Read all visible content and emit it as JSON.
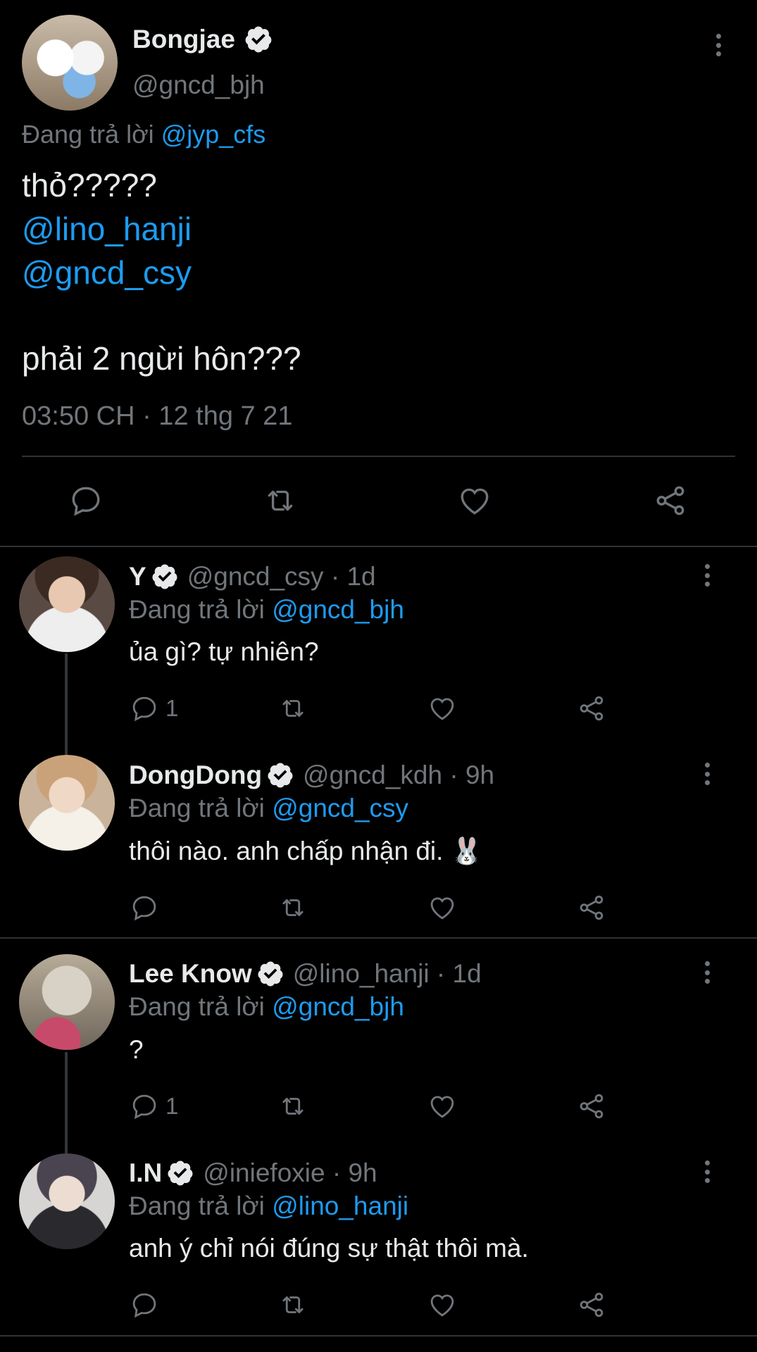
{
  "main_tweet": {
    "name": "Bongjae",
    "handle": "@gncd_bjh",
    "replying_prefix": "Đang trả lời ",
    "replying_to": "@jyp_cfs",
    "line1": "thỏ?????",
    "mention1": "@lino_hanji",
    "mention2": "@gncd_csy",
    "line2": "phải 2 ngừi hôn???",
    "timestamp": "03:50 CH · 12 thg 7 21"
  },
  "replies": [
    {
      "name": "Y",
      "handle": "@gncd_csy · 1d",
      "replying_prefix": "Đang trả lời ",
      "replying_to": "@gncd_bjh",
      "text": "ủa gì? tự nhiên?",
      "reply_count": "1"
    },
    {
      "name": "DongDong",
      "handle": "@gncd_kdh · 9h",
      "replying_prefix": "Đang trả lời ",
      "replying_to": "@gncd_csy",
      "text": "thôi nào. anh chấp nhận đi. 🐰",
      "reply_count": ""
    },
    {
      "name": "Lee Know",
      "handle": "@lino_hanji · 1d",
      "replying_prefix": "Đang trả lời ",
      "replying_to": "@gncd_bjh",
      "text": "?",
      "reply_count": "1"
    },
    {
      "name": "I.N",
      "handle": "@iniefoxie · 9h",
      "replying_prefix": "Đang trả lời ",
      "replying_to": "@lino_hanji",
      "text": "anh ý chỉ nói đúng sự thật thôi mà.",
      "reply_count": ""
    }
  ],
  "icons": {
    "reply": "reply-icon",
    "retweet": "retweet-icon",
    "like": "heart-icon",
    "share": "share-icon",
    "more": "more-icon",
    "verified": "verified-badge-icon"
  },
  "colors": {
    "background": "#000000",
    "text": "#e7e9ea",
    "secondary": "#71767b",
    "link": "#1d9bf0",
    "divider": "#2f3336"
  }
}
